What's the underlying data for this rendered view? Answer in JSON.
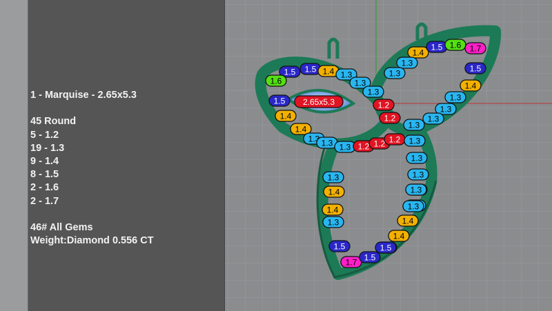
{
  "info_panel": {
    "line_marquise": "1 - Marquise - 2.65x5.3",
    "round_header": "45 Round",
    "sizes": [
      "5 - 1.2",
      "19 - 1.3",
      "9 - 1.4",
      "8 - 1.5",
      "2 - 1.6",
      "2 - 1.7"
    ],
    "all_gems": "46# All Gems",
    "weight": "Weight:Diamond 0.556 CT"
  },
  "model": {
    "marquise_label": "2.65x5.3",
    "stone_labels": [
      {
        "text": "1.5",
        "color": "#2a27c9"
      },
      {
        "text": "1.5",
        "color": "#2a27c9"
      },
      {
        "text": "1.4",
        "color": "#f2b000"
      },
      {
        "text": "1.6",
        "color": "#54e014"
      },
      {
        "text": "1.3",
        "color": "#29b6f0"
      },
      {
        "text": "1.3",
        "color": "#29b6f0"
      },
      {
        "text": "1.3",
        "color": "#29b6f0"
      },
      {
        "text": "1.5",
        "color": "#2a27c9"
      },
      {
        "text": "1.4",
        "color": "#f2b000"
      },
      {
        "text": "1.4",
        "color": "#f2b000"
      },
      {
        "text": "1.3",
        "color": "#29b6f0"
      },
      {
        "text": "1.3",
        "color": "#29b6f0"
      },
      {
        "text": "1.3",
        "color": "#29b6f0"
      },
      {
        "text": "1.2",
        "color": "#e01423"
      },
      {
        "text": "1.2",
        "color": "#e01423"
      },
      {
        "text": "1.2",
        "color": "#e01423"
      },
      {
        "text": "1.2",
        "color": "#e01423"
      },
      {
        "text": "1.2",
        "color": "#e01423"
      },
      {
        "text": "1.4",
        "color": "#f2b000"
      },
      {
        "text": "1.5",
        "color": "#2a27c9"
      },
      {
        "text": "1.6",
        "color": "#54e014"
      },
      {
        "text": "1.7",
        "color": "#ff1fc8"
      },
      {
        "text": "1.3",
        "color": "#29b6f0"
      },
      {
        "text": "1.3",
        "color": "#29b6f0"
      },
      {
        "text": "1.5",
        "color": "#2a27c9"
      },
      {
        "text": "1.4",
        "color": "#f2b000"
      },
      {
        "text": "1.3",
        "color": "#29b6f0"
      },
      {
        "text": "1.3",
        "color": "#29b6f0"
      },
      {
        "text": "1.3",
        "color": "#29b6f0"
      },
      {
        "text": "1.3",
        "color": "#29b6f0"
      },
      {
        "text": "1.3",
        "color": "#29b6f0"
      },
      {
        "text": "1.3",
        "color": "#29b6f0"
      },
      {
        "text": "1.3",
        "color": "#29b6f0"
      },
      {
        "text": "1.3",
        "color": "#29b6f0"
      },
      {
        "text": "1.3",
        "color": "#29b6f0"
      },
      {
        "text": "1.3",
        "color": "#29b6f0"
      },
      {
        "text": "1.4",
        "color": "#f2b000"
      },
      {
        "text": "1.4",
        "color": "#f2b000"
      },
      {
        "text": "1.5",
        "color": "#2a27c9"
      },
      {
        "text": "1.3",
        "color": "#29b6f0"
      },
      {
        "text": "1.3",
        "color": "#29b6f0"
      },
      {
        "text": "1.4",
        "color": "#f2b000"
      },
      {
        "text": "1.4",
        "color": "#f2b000"
      },
      {
        "text": "1.5",
        "color": "#2a27c9"
      },
      {
        "text": "1.7",
        "color": "#ff1fc8"
      },
      {
        "text": "1.5",
        "color": "#2a27c9"
      },
      {
        "text": "1.5",
        "color": "#2a27c9"
      },
      {
        "text": "1.3",
        "color": "#29b6f0"
      }
    ]
  },
  "colors": {
    "panel": "#555556",
    "viewport_bg": "#8a8c8e",
    "grid": "#9b9da0",
    "jewel_green": "#1c7a57",
    "axis_red": "#b33",
    "axis_green": "#2a9a2a"
  }
}
